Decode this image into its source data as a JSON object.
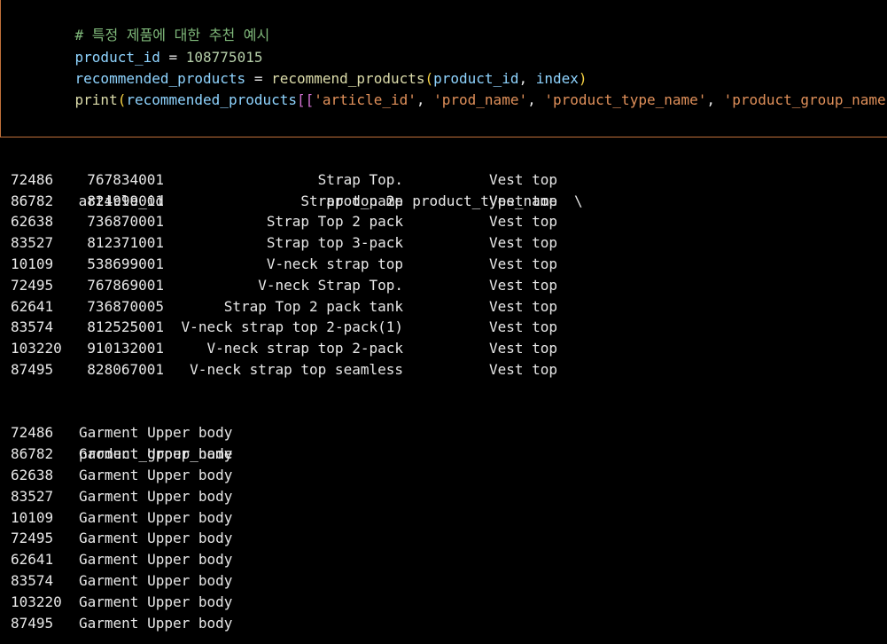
{
  "code": {
    "comment": "# 특정 제품에 대한 추천 예시",
    "line2": {
      "var": "product_id",
      "op": " = ",
      "num": "108775015"
    },
    "line3": {
      "var": "recommended_products",
      "op": " = ",
      "fn": "recommend_products",
      "open": "(",
      "arg1": "product_id",
      "sep": ", ",
      "arg2": "index",
      "close": ")"
    },
    "line4": {
      "fn": "print",
      "open": "(",
      "var": "recommended_products",
      "bopen": "[[",
      "s1": "'article_id'",
      "sep": ", ",
      "s2": "'prod_name'",
      "s3": "'product_type_name'",
      "s4": "'product_group_name'",
      "bclose": "]]",
      "close": ")"
    }
  },
  "table1": {
    "headers": {
      "article_id": "article_id",
      "prod_name": "prod_name",
      "product_type_name": "product_type_name",
      "continuation": "\\"
    },
    "rows": [
      {
        "idx": "72486",
        "article_id": "767834001",
        "prod_name": "Strap Top.",
        "product_type_name": "Vest top"
      },
      {
        "idx": "86782",
        "article_id": "824999001",
        "prod_name": "Strap top 2p",
        "product_type_name": "Vest top"
      },
      {
        "idx": "62638",
        "article_id": "736870001",
        "prod_name": "Strap Top 2 pack",
        "product_type_name": "Vest top"
      },
      {
        "idx": "83527",
        "article_id": "812371001",
        "prod_name": "Strap top 3-pack",
        "product_type_name": "Vest top"
      },
      {
        "idx": "10109",
        "article_id": "538699001",
        "prod_name": "V-neck strap top",
        "product_type_name": "Vest top"
      },
      {
        "idx": "72495",
        "article_id": "767869001",
        "prod_name": "V-neck Strap Top.",
        "product_type_name": "Vest top"
      },
      {
        "idx": "62641",
        "article_id": "736870005",
        "prod_name": "Strap Top 2 pack tank",
        "product_type_name": "Vest top"
      },
      {
        "idx": "83574",
        "article_id": "812525001",
        "prod_name": "V-neck strap top 2-pack(1)",
        "product_type_name": "Vest top"
      },
      {
        "idx": "103220",
        "article_id": "910132001",
        "prod_name": "V-neck strap top 2-pack",
        "product_type_name": "Vest top"
      },
      {
        "idx": "87495",
        "article_id": "828067001",
        "prod_name": "V-neck strap top seamless",
        "product_type_name": "Vest top"
      }
    ]
  },
  "table2": {
    "headers": {
      "product_group_name": "product_group_name"
    },
    "rows": [
      {
        "idx": "72486",
        "product_group_name": "Garment Upper body"
      },
      {
        "idx": "86782",
        "product_group_name": "Garment Upper body"
      },
      {
        "idx": "62638",
        "product_group_name": "Garment Upper body"
      },
      {
        "idx": "83527",
        "product_group_name": "Garment Upper body"
      },
      {
        "idx": "10109",
        "product_group_name": "Garment Upper body"
      },
      {
        "idx": "72495",
        "product_group_name": "Garment Upper body"
      },
      {
        "idx": "62641",
        "product_group_name": "Garment Upper body"
      },
      {
        "idx": "83574",
        "product_group_name": "Garment Upper body"
      },
      {
        "idx": "103220",
        "product_group_name": "Garment Upper body"
      },
      {
        "idx": "87495",
        "product_group_name": "Garment Upper body"
      }
    ]
  },
  "colors": {
    "cell_border": "#c0703a",
    "comment": "#7fb87a",
    "variable": "#8fd4ff",
    "number": "#b5cea8",
    "function": "#dcdcaa",
    "string": "#e0905a"
  }
}
